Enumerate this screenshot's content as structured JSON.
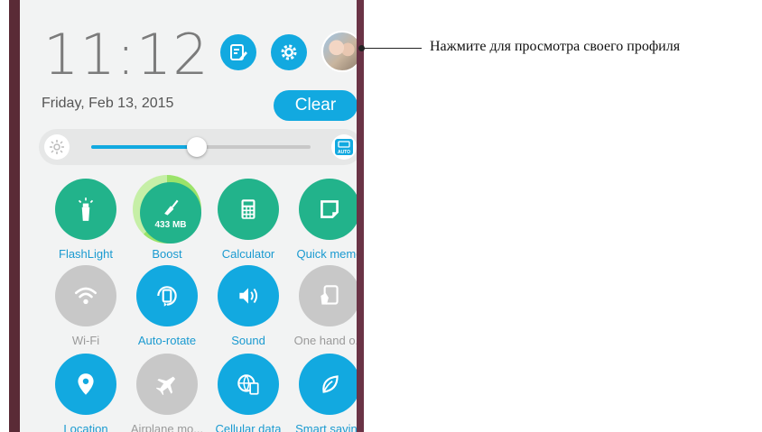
{
  "clock": {
    "time": "11:12",
    "date": "Friday, Feb 13, 2015"
  },
  "header": {
    "edit_icon": "edit-settings-icon",
    "settings_icon": "gear-icon",
    "avatar_icon": "profile-avatar",
    "clear_label": "Clear"
  },
  "brightness": {
    "level": 0.48,
    "auto_label": "AUTO"
  },
  "tiles": [
    {
      "label": "FlashLight",
      "icon": "flashlight-icon",
      "state": "on"
    },
    {
      "label": "Boost",
      "icon": "broom-icon",
      "state": "on",
      "badge": "433 MB"
    },
    {
      "label": "Calculator",
      "icon": "calculator-icon",
      "state": "on"
    },
    {
      "label": "Quick memo",
      "icon": "memo-icon",
      "state": "on"
    },
    {
      "label": "Wi-Fi",
      "icon": "wifi-icon",
      "state": "off"
    },
    {
      "label": "Auto-rotate",
      "icon": "rotate-icon",
      "state": "active"
    },
    {
      "label": "Sound",
      "icon": "sound-icon",
      "state": "active"
    },
    {
      "label": "One hand o...",
      "icon": "one-hand-icon",
      "state": "off"
    },
    {
      "label": "Location",
      "icon": "location-icon",
      "state": "active"
    },
    {
      "label": "Airplane mo...",
      "icon": "airplane-icon",
      "state": "off"
    },
    {
      "label": "Cellular data",
      "icon": "cellular-data-icon",
      "state": "active"
    },
    {
      "label": "Smart saving",
      "icon": "leaf-icon",
      "state": "active"
    }
  ],
  "colors": {
    "accent": "#12a9e0",
    "green": "#22b38b",
    "off": "#c8c8c8"
  },
  "callout": {
    "text": "Нажмите для просмотра своего профиля"
  }
}
